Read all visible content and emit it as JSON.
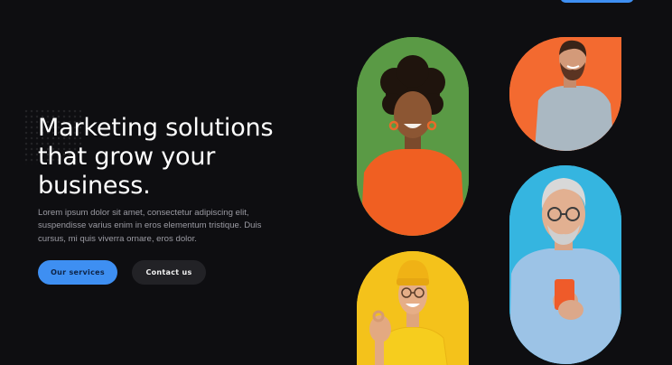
{
  "hero": {
    "title": "Marketing solutions that grow your business.",
    "description": "Lorem ipsum dolor sit amet, consectetur adipiscing elit, suspendisse varius enim in eros elementum tristique. Duis cursus, mi quis viverra ornare, eros dolor.",
    "primary_button": "Our services",
    "secondary_button": "Contact us"
  },
  "colors": {
    "background": "#0e0e11",
    "accent": "#3e8ff2",
    "card_green": "#5a9a45",
    "card_orange": "#f36a30",
    "card_yellow": "#f4c21b",
    "card_blue": "#35b5e0"
  }
}
